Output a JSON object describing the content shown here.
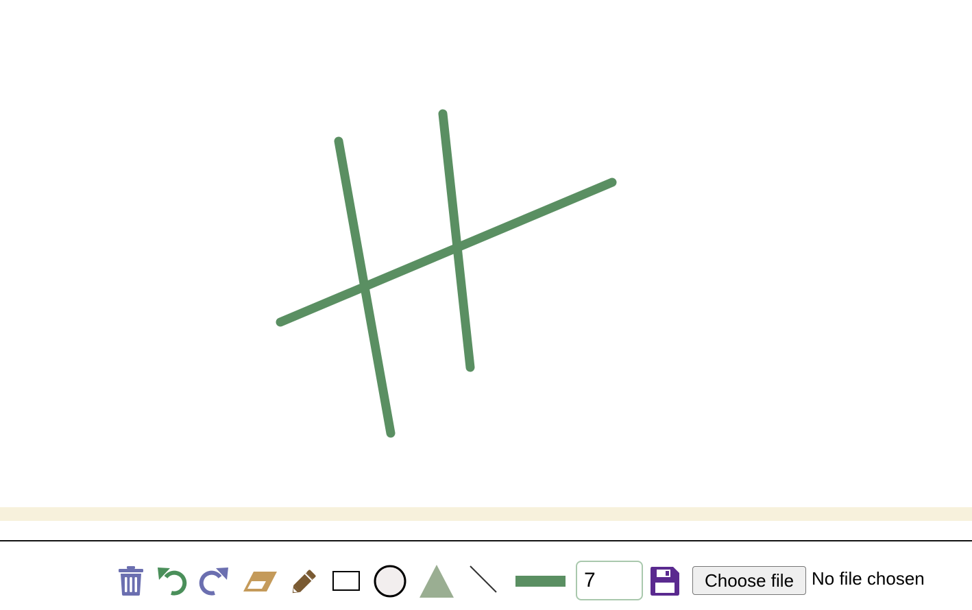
{
  "canvas": {
    "stroke_color": "#5a8f62",
    "background": "#ffffff"
  },
  "toolbar": {
    "tools": [
      {
        "name": "clear",
        "icon": "trash-icon",
        "color": "#6b6fb0"
      },
      {
        "name": "undo",
        "icon": "undo-icon",
        "color": "#4a8f5a"
      },
      {
        "name": "redo",
        "icon": "redo-icon",
        "color": "#6b6fb0"
      },
      {
        "name": "eraser",
        "icon": "eraser-icon",
        "color": "#c49a5a"
      },
      {
        "name": "pencil",
        "icon": "pencil-icon",
        "color": "#7a5a32"
      },
      {
        "name": "rectangle",
        "icon": "rectangle-icon",
        "color": "#000000"
      },
      {
        "name": "circle",
        "icon": "circle-icon",
        "color": "#000000"
      },
      {
        "name": "triangle",
        "icon": "triangle-icon",
        "color": "#9aae92"
      },
      {
        "name": "line",
        "icon": "line-icon",
        "color": "#333333"
      },
      {
        "name": "color-swatch",
        "icon": "color-swatch-icon",
        "color": "#5a8f62"
      },
      {
        "name": "save",
        "icon": "save-icon",
        "color": "#5a2a8f"
      }
    ],
    "brush_size": "7",
    "choose_file_label": "Choose file",
    "file_status": "No file chosen"
  },
  "colors": {
    "band": "#f7f1dc",
    "divider": "#111111"
  }
}
